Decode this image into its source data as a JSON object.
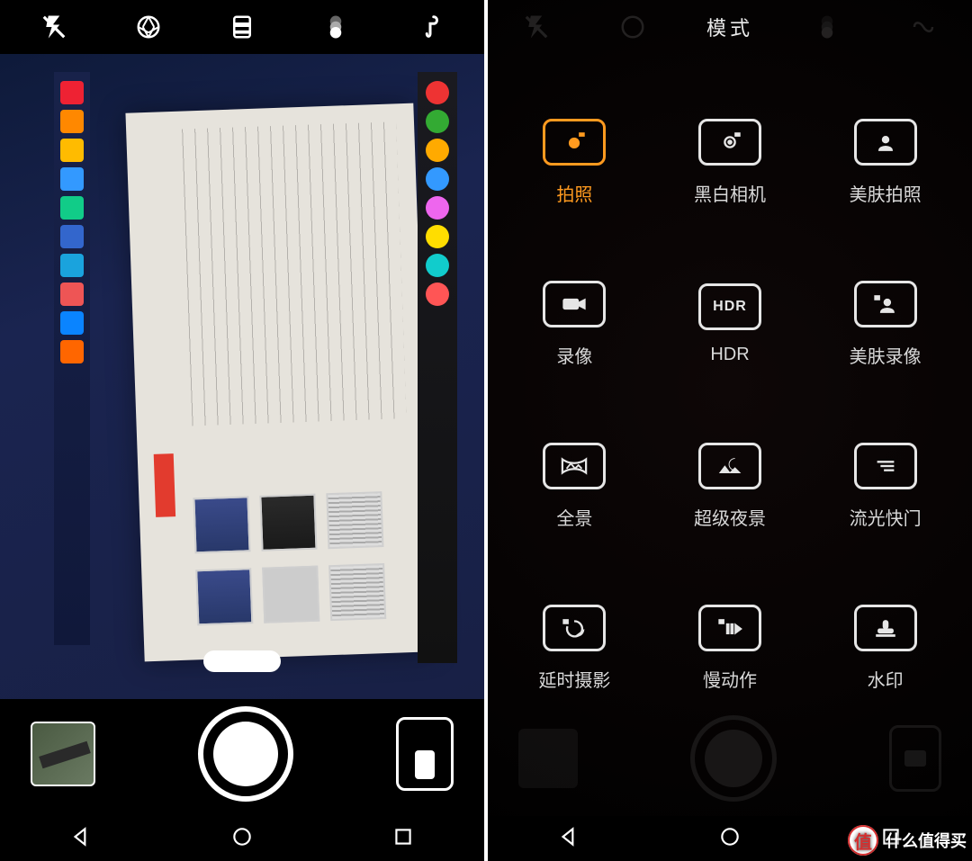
{
  "colors": {
    "accent": "#ff9a1f"
  },
  "left": {
    "top_icons": [
      "flash-off-icon",
      "aperture-icon",
      "filter-icon",
      "stack-icon",
      "hook-icon"
    ],
    "page_indicator": {
      "count": 3,
      "active_index": 1
    }
  },
  "right": {
    "title": "模式",
    "top_ghost_icons": [
      "flash-off-icon",
      "aperture-icon",
      "stack-icon",
      "loop-icon"
    ],
    "modes": [
      {
        "id": "photo",
        "label": "拍照",
        "icon": "camera-icon",
        "active": true
      },
      {
        "id": "monochrome",
        "label": "黑白相机",
        "icon": "camera-bw-icon",
        "active": false
      },
      {
        "id": "beauty-photo",
        "label": "美肤拍照",
        "icon": "portrait-icon",
        "active": false
      },
      {
        "id": "video",
        "label": "录像",
        "icon": "video-icon",
        "active": false
      },
      {
        "id": "hdr",
        "label": "HDR",
        "icon": "hdr-icon",
        "active": false
      },
      {
        "id": "beauty-video",
        "label": "美肤录像",
        "icon": "portrait-video-icon",
        "active": false
      },
      {
        "id": "panorama",
        "label": "全景",
        "icon": "panorama-icon",
        "active": false
      },
      {
        "id": "night",
        "label": "超级夜景",
        "icon": "night-icon",
        "active": false
      },
      {
        "id": "light-paint",
        "label": "流光快门",
        "icon": "light-trail-icon",
        "active": false
      },
      {
        "id": "timelapse",
        "label": "延时摄影",
        "icon": "timelapse-icon",
        "active": false
      },
      {
        "id": "slowmo",
        "label": "慢动作",
        "icon": "slowmo-icon",
        "active": false
      },
      {
        "id": "watermark",
        "label": "水印",
        "icon": "stamp-icon",
        "active": false
      }
    ],
    "page_indicator": {
      "count": 3,
      "active_index": 1
    }
  },
  "watermark": {
    "badge": "值",
    "text": "什么值得买"
  }
}
